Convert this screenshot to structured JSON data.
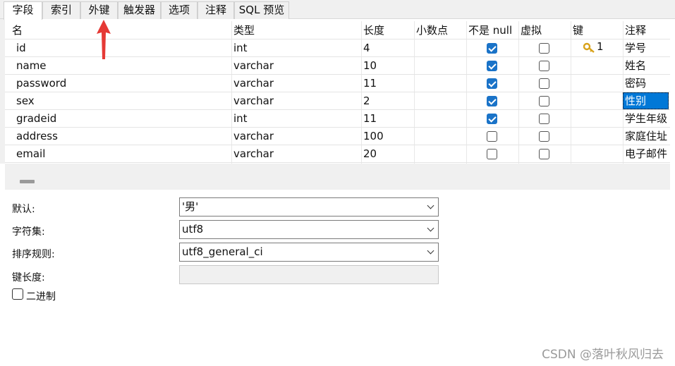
{
  "tabs": [
    "字段",
    "索引",
    "外键",
    "触发器",
    "选项",
    "注释",
    "SQL 预览"
  ],
  "active_tab": "字段",
  "columns": [
    "名",
    "类型",
    "长度",
    "小数点",
    "不是 null",
    "虚拟",
    "键",
    "注释"
  ],
  "rows": [
    {
      "name": "id",
      "type": "int",
      "length": "4",
      "decimals": "",
      "not_null": true,
      "virtual": false,
      "key": "1",
      "comment": "学号"
    },
    {
      "name": "name",
      "type": "varchar",
      "length": "10",
      "decimals": "",
      "not_null": true,
      "virtual": false,
      "key": "",
      "comment": "姓名"
    },
    {
      "name": "password",
      "type": "varchar",
      "length": "11",
      "decimals": "",
      "not_null": true,
      "virtual": false,
      "key": "",
      "comment": "密码"
    },
    {
      "name": "sex",
      "type": "varchar",
      "length": "2",
      "decimals": "",
      "not_null": true,
      "virtual": false,
      "key": "",
      "comment": "性别"
    },
    {
      "name": "gradeid",
      "type": "int",
      "length": "11",
      "decimals": "",
      "not_null": true,
      "virtual": false,
      "key": "",
      "comment": "学生年级"
    },
    {
      "name": "address",
      "type": "varchar",
      "length": "100",
      "decimals": "",
      "not_null": false,
      "virtual": false,
      "key": "",
      "comment": "家庭住址"
    },
    {
      "name": "email",
      "type": "varchar",
      "length": "20",
      "decimals": "",
      "not_null": false,
      "virtual": false,
      "key": "",
      "comment": "电子邮件"
    }
  ],
  "properties": {
    "default_label": "默认:",
    "default_value": "'男'",
    "charset_label": "字符集:",
    "charset_value": "utf8",
    "collation_label": "排序规则:",
    "collation_value": "utf8_general_ci",
    "keylen_label": "键长度:",
    "keylen_value": "",
    "binary_label": "二进制"
  },
  "watermark": "CSDN @落叶秋风归去",
  "colors": {
    "checkbox_on": "#1a73c8",
    "selection": "#0078d7",
    "arrow": "#e53935",
    "key_icon": "#d8a21a"
  }
}
